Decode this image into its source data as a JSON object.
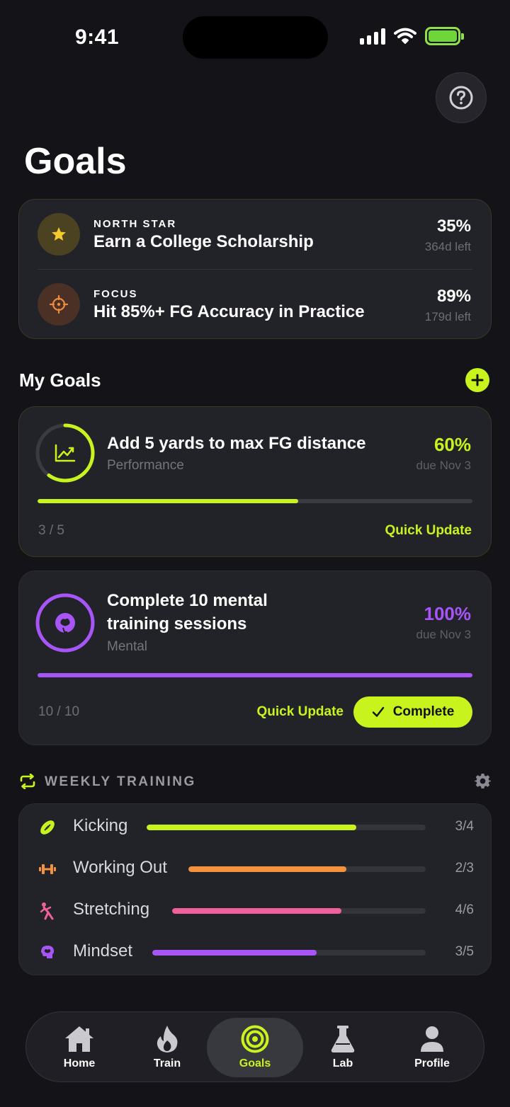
{
  "status_bar": {
    "time": "9:41"
  },
  "page": {
    "title": "Goals"
  },
  "north_star": [
    {
      "label": "NORTH STAR",
      "title": "Earn a College Scholarship",
      "percent": "35%",
      "days_left": "364d left",
      "color": "#e8c12a",
      "icon": "star-icon"
    },
    {
      "label": "FOCUS",
      "title": "Hit 85%+ FG Accuracy in Practice",
      "percent": "89%",
      "days_left": "179d left",
      "color": "#f08a3c",
      "icon": "target-icon"
    }
  ],
  "my_goals": {
    "title": "My Goals",
    "items": [
      {
        "title": "Add 5 yards to max FG distance",
        "category": "Performance",
        "percent": "60%",
        "progress": 0.6,
        "due": "due Nov 3",
        "count": "3 / 5",
        "quick_update": "Quick Update",
        "color": "#c8f31d",
        "icon": "chart-icon"
      },
      {
        "title_line1": "Complete 10 mental",
        "title_line2": "training sessions",
        "category": "Mental",
        "percent": "100%",
        "progress": 1.0,
        "due": "due Nov 3",
        "count": "10 / 10",
        "quick_update": "Quick Update",
        "complete_label": "Complete",
        "color": "#a855f7",
        "icon": "brain-icon"
      }
    ]
  },
  "weekly_training": {
    "title": "WEEKLY TRAINING",
    "items": [
      {
        "label": "Kicking",
        "count": "3/4",
        "progress": 0.75,
        "color": "#c8f31d",
        "icon": "football-icon"
      },
      {
        "label": "Working Out",
        "count": "2/3",
        "progress": 0.667,
        "color": "#f5923e",
        "icon": "dumbbell-icon"
      },
      {
        "label": "Stretching",
        "count": "4/6",
        "progress": 0.667,
        "color": "#f0609a",
        "icon": "stretch-icon"
      },
      {
        "label": "Mindset",
        "count": "3/5",
        "progress": 0.6,
        "color": "#a855f7",
        "icon": "brain-icon"
      }
    ]
  },
  "tabs": [
    {
      "label": "Home",
      "icon": "home-icon"
    },
    {
      "label": "Train",
      "icon": "flame-icon"
    },
    {
      "label": "Goals",
      "icon": "target-icon",
      "active": true
    },
    {
      "label": "Lab",
      "icon": "flask-icon"
    },
    {
      "label": "Profile",
      "icon": "person-icon"
    }
  ]
}
